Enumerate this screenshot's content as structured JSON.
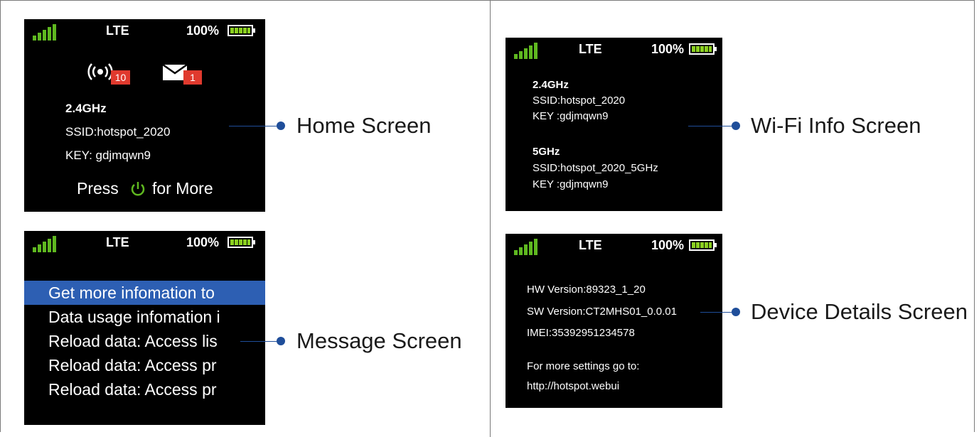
{
  "status": {
    "network": "LTE",
    "battery": "100%",
    "colors": {
      "signal": "#5fb820",
      "battery_fill": "#8bd020"
    }
  },
  "home": {
    "hotspot_count": "10",
    "message_count": "1",
    "band": "2.4GHz",
    "ssid": "SSID:hotspot_2020",
    "key": "KEY: gdjmqwn9",
    "press_prefix": "Press",
    "press_suffix": "for More",
    "label": "Home Screen"
  },
  "wifi": {
    "band1": "2.4GHz",
    "ssid1": "SSID:hotspot_2020",
    "key1": "KEY :gdjmqwn9",
    "band2": "5GHz",
    "ssid2": "SSID:hotspot_2020_5GHz",
    "key2": "KEY :gdjmqwn9",
    "label": "Wi-Fi Info Screen"
  },
  "message": {
    "items": [
      "Get more infomation to",
      "Data usage infomation i",
      "Reload data: Access lis",
      "Reload data: Access pr",
      "Reload data: Access pr"
    ],
    "label": "Message Screen"
  },
  "device": {
    "hw": "HW Version:89323_1_20",
    "sw": "SW Version:CT2MHS01_0.0.01",
    "imei": "IMEI:35392951234578",
    "more": "For more settings go to:",
    "url": "http://hotspot.webui",
    "label": "Device Details Screen"
  },
  "accent": "#1f4e9a",
  "highlight": "#2d5fb3"
}
